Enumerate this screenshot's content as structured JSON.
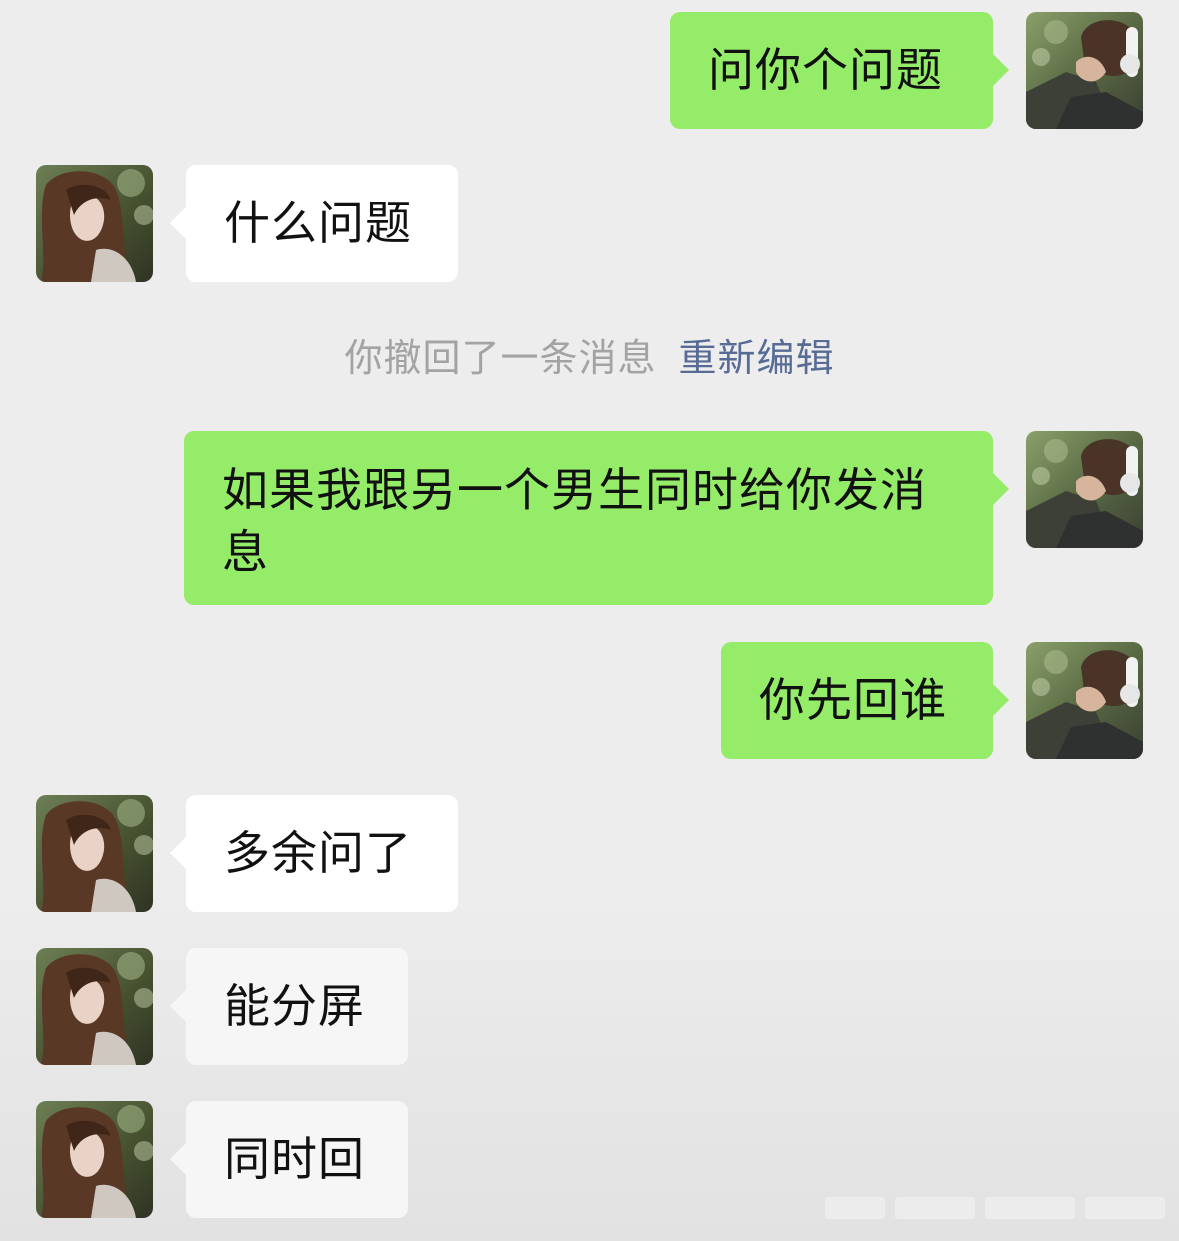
{
  "messages": [
    {
      "sender": "me",
      "text": "问你个问题"
    },
    {
      "sender": "them",
      "text": "什么问题"
    },
    {
      "type": "system",
      "text": "你撤回了一条消息",
      "action": "重新编辑"
    },
    {
      "sender": "me",
      "text": "如果我跟另一个男生同时给你发消息"
    },
    {
      "sender": "me",
      "text": "你先回谁"
    },
    {
      "sender": "them",
      "text": "多余问了"
    },
    {
      "sender": "them",
      "text": "能分屏"
    },
    {
      "sender": "them",
      "text": "同时回"
    }
  ],
  "colors": {
    "background": "#ededed",
    "outgoing_bubble": "#95ec69",
    "incoming_bubble": "#ffffff",
    "system_text": "#a3a3a3",
    "link_text": "#576b95"
  },
  "icons": {
    "my_avatar": "avatar-boy-headphones",
    "their_avatar": "avatar-girl-long-hair"
  }
}
